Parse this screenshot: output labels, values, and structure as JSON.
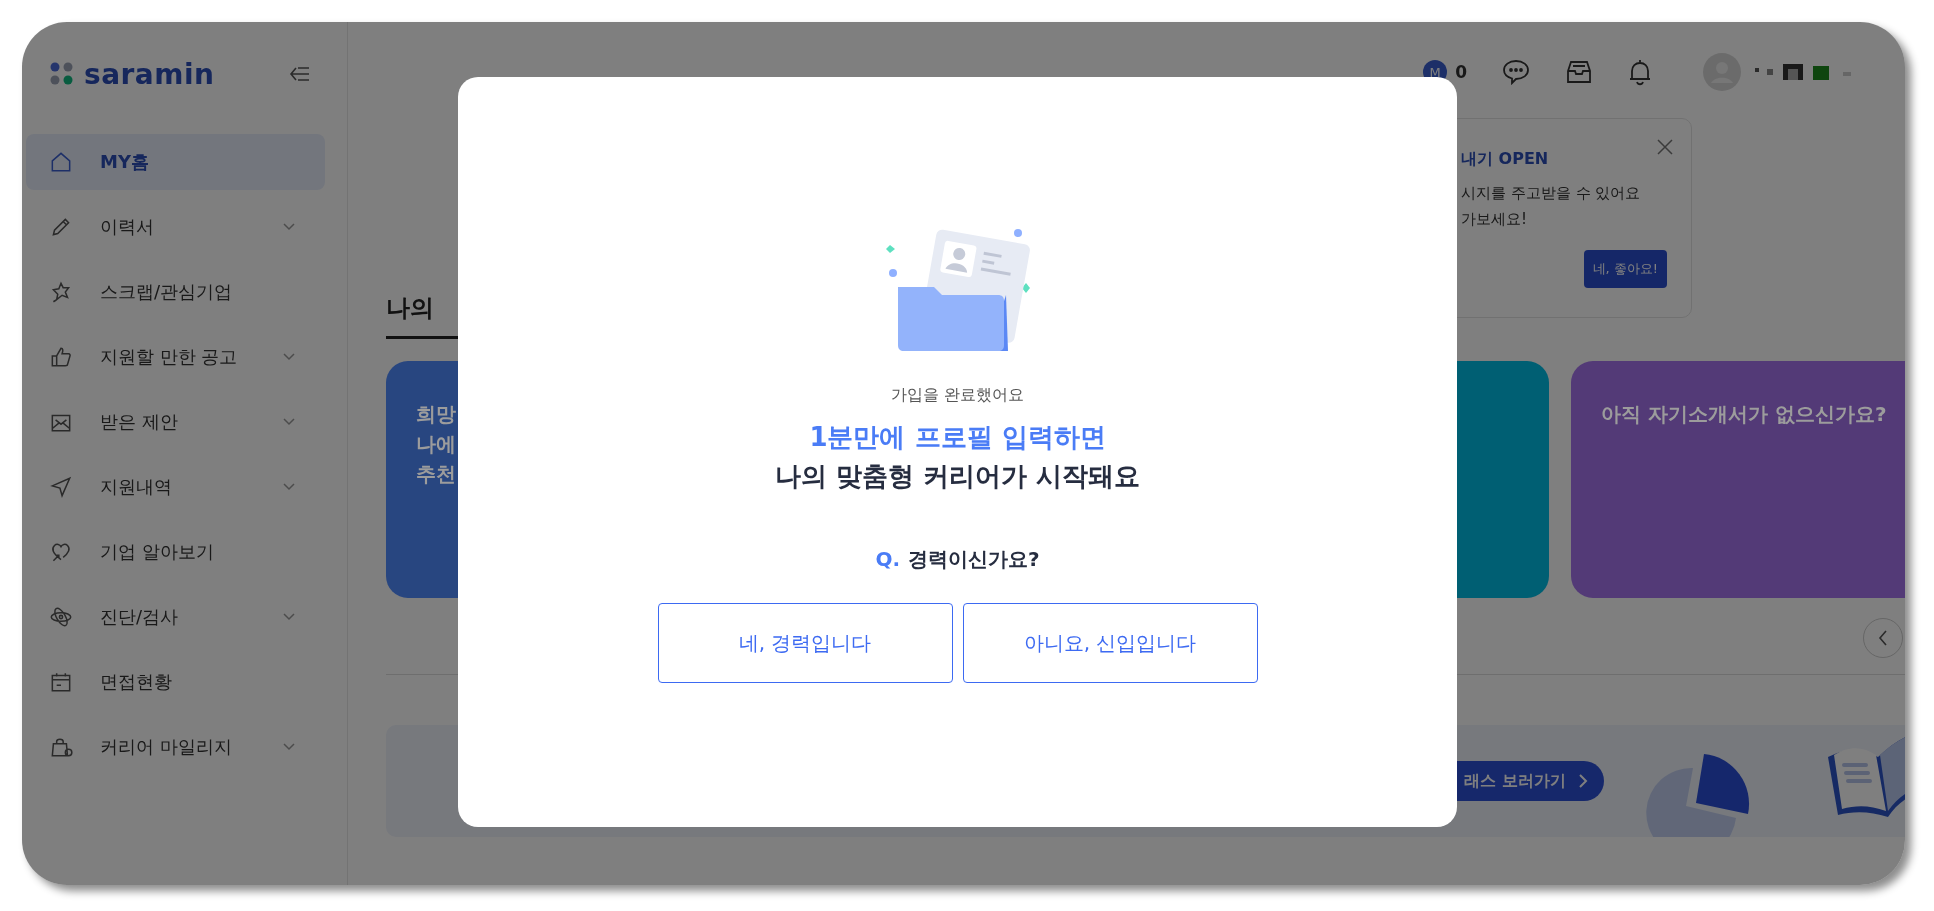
{
  "logo": {
    "text": "saramin"
  },
  "sidebar": {
    "items": [
      {
        "label": "MY홈",
        "expandable": false,
        "selected": true
      },
      {
        "label": "이력서",
        "expandable": true,
        "selected": false
      },
      {
        "label": "스크랩/관심기업",
        "expandable": false,
        "selected": false
      },
      {
        "label": "지원할 만한 공고",
        "expandable": true,
        "selected": false
      },
      {
        "label": "받은 제안",
        "expandable": true,
        "selected": false
      },
      {
        "label": "지원내역",
        "expandable": true,
        "selected": false
      },
      {
        "label": "기업 알아보기",
        "expandable": false,
        "selected": false
      },
      {
        "label": "진단/검사",
        "expandable": true,
        "selected": false
      },
      {
        "label": "면접현황",
        "expandable": false,
        "selected": false
      },
      {
        "label": "커리어 마일리지",
        "expandable": true,
        "selected": false
      }
    ]
  },
  "topbar": {
    "mileage": {
      "badge": "M",
      "count": "0"
    }
  },
  "section_title": "나의",
  "cards": [
    {
      "lines": [
        "희망",
        "나에",
        "추천"
      ],
      "color": "#284680"
    },
    {
      "color": "#005f73"
    },
    {
      "lines": [
        "아직 자기소개서가 없으신가요?"
      ],
      "color": "#533a77"
    }
  ],
  "popover": {
    "title": "내기 OPEN",
    "lines": [
      "시지를 주고받을 수 있어요",
      "가보세요!"
    ],
    "button": "네, 좋아요!"
  },
  "banner": {
    "button": "래스 보러가기"
  },
  "modal": {
    "subtitle": "가입을 완료했어요",
    "headline": "1분만에 프로필 입력하면",
    "headline2": "나의 맞춤형 커리어가 시작돼요",
    "question": {
      "prefix": "Q.",
      "text": "경력이신가요?"
    },
    "buttons": [
      "네, 경력입니다",
      "아니요, 신입입니다"
    ]
  }
}
